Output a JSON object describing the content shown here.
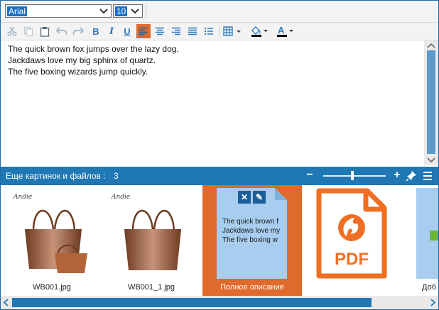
{
  "font_bar": {
    "font_name": "Arial",
    "font_size": "10"
  },
  "toolbar": {
    "buttons": [
      "cut-icon",
      "copy-icon",
      "paste-icon",
      "undo-icon",
      "redo-icon",
      "bold",
      "italic",
      "underline",
      "align-left",
      "align-center",
      "align-right",
      "justify",
      "bullet-list",
      "table",
      "fill-color",
      "font-color"
    ],
    "bold_label": "B",
    "italic_label": "I",
    "underline_label": "U",
    "font_color_label": "A",
    "accent_color": "#e06a2b"
  },
  "editor": {
    "lines": [
      "The quick brown fox jumps over the lazy dog.",
      "Jackdaws love my big sphinx of quartz.",
      "The five boxing wizards jump quickly."
    ]
  },
  "attachments": {
    "title": "Еще картинок и файлов :",
    "count": "3",
    "zoom_minus": "−",
    "zoom_plus": "+",
    "zoom_level": 0.47,
    "items": [
      {
        "caption": "WB001.jpg",
        "brand": "Andie"
      },
      {
        "caption": "WB001_1.jpg",
        "brand": "Andie"
      },
      {
        "caption": "Полное описание",
        "preview_lines": [
          "The quick brown f",
          "Jackdaws love my",
          "The five boxing w"
        ],
        "close_label": "✕",
        "edit_label": "✎"
      },
      {
        "caption": "",
        "pdf_label": "PDF"
      },
      {
        "caption": "Доб"
      }
    ]
  },
  "colors": {
    "bar_blue": "#1f77b4",
    "selection_orange": "#e06a2b",
    "doc_blue": "#a8cdee",
    "pdf_orange": "#f06f22"
  }
}
